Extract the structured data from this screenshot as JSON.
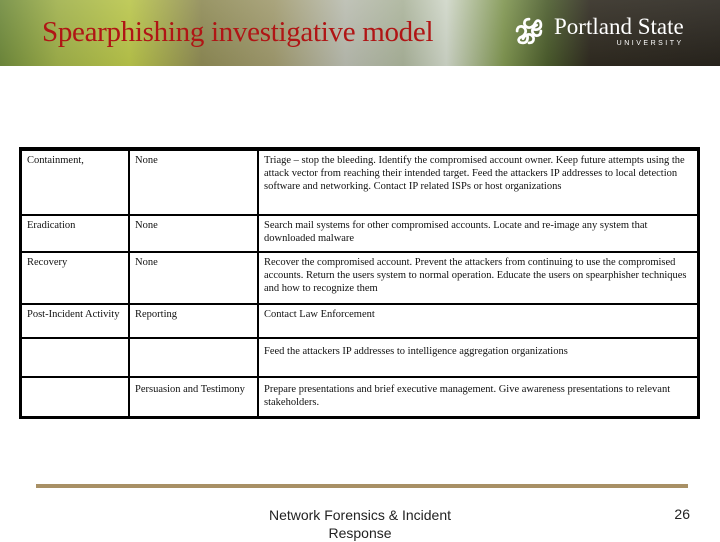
{
  "slide": {
    "title": "Spearphishing investigative model",
    "logo": {
      "icon": "psu-knot-logo-icon",
      "name": "Portland State",
      "subtitle": "UNIVERSITY"
    }
  },
  "table": {
    "rows": [
      {
        "phase": "Containment,",
        "action": "None",
        "description": "Triage – stop the bleeding.  Identify the compromised account owner. Keep future attempts using the attack vector from reaching their intended target.  Feed the attackers IP addresses to local detection software and networking.  Contact IP related ISPs or host organizations"
      },
      {
        "phase": "Eradication",
        "action": "None",
        "description": "Search mail systems for other compromised accounts.  Locate and re-image any system that downloaded malware"
      },
      {
        "phase": "Recovery",
        "action": "None",
        "description": "Recover the compromised account. Prevent the attackers from continuing to use the compromised accounts.  Return the users system to normal operation.  Educate the users on spearphisher techniques and how to recognize them"
      },
      {
        "phase": "Post-Incident Activity",
        "action": "Reporting",
        "description": "Contact Law Enforcement"
      },
      {
        "phase": "",
        "action": "",
        "description": "Feed the attackers IP addresses to intelligence aggregation organizations"
      },
      {
        "phase": "",
        "action": "Persuasion and Testimony",
        "description": "Prepare presentations and brief executive management.  Give awareness presentations to relevant stakeholders."
      }
    ]
  },
  "footer": {
    "text": "Network Forensics & Incident Response",
    "page_number": "26"
  },
  "colors": {
    "title": "#b01515",
    "footer_rule": "#a89065"
  }
}
